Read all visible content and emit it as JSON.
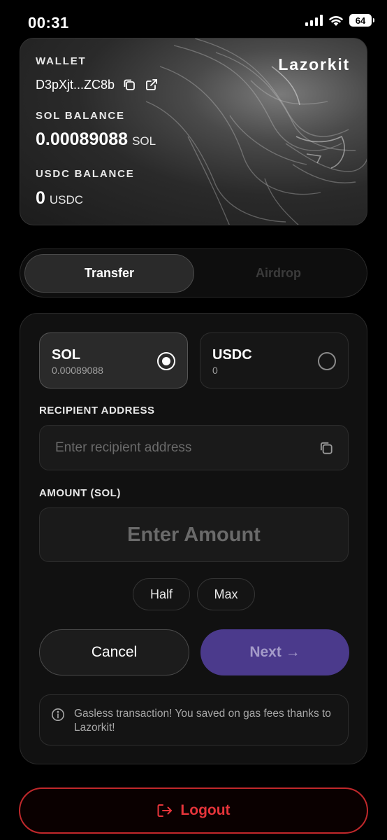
{
  "status_bar": {
    "time": "00:31",
    "battery": "64"
  },
  "wallet_card": {
    "wallet_label": "WALLET",
    "brand": "Lazorkit",
    "address": "D3pXjt...ZC8b",
    "sol_label": "SOL BALANCE",
    "sol_amount": "0.00089088",
    "sol_unit": "SOL",
    "usdc_label": "USDC BALANCE",
    "usdc_amount": "0",
    "usdc_unit": "USDC"
  },
  "tabs": [
    {
      "label": "Transfer",
      "active": true
    },
    {
      "label": "Airdrop",
      "active": false
    }
  ],
  "tokens": [
    {
      "name": "SOL",
      "balance": "0.00089088",
      "selected": true
    },
    {
      "name": "USDC",
      "balance": "0",
      "selected": false
    }
  ],
  "form": {
    "recipient_label": "RECIPIENT ADDRESS",
    "recipient_placeholder": "Enter recipient address",
    "recipient_value": "",
    "amount_label": "AMOUNT (SOL)",
    "amount_placeholder": "Enter Amount",
    "amount_value": "",
    "half_label": "Half",
    "max_label": "Max",
    "cancel_label": "Cancel",
    "next_label": "Next →"
  },
  "notice": {
    "text": "Gasless transaction! You saved on gas fees thanks to Lazorkit!"
  },
  "logout": {
    "label": "Logout"
  },
  "colors": {
    "accent": "#4b3a8c",
    "danger": "#e5343a",
    "background": "#000000"
  },
  "icons": [
    "signal-icon",
    "wifi-icon",
    "battery-icon",
    "copy-icon",
    "external-link-icon",
    "info-icon",
    "logout-icon"
  ]
}
